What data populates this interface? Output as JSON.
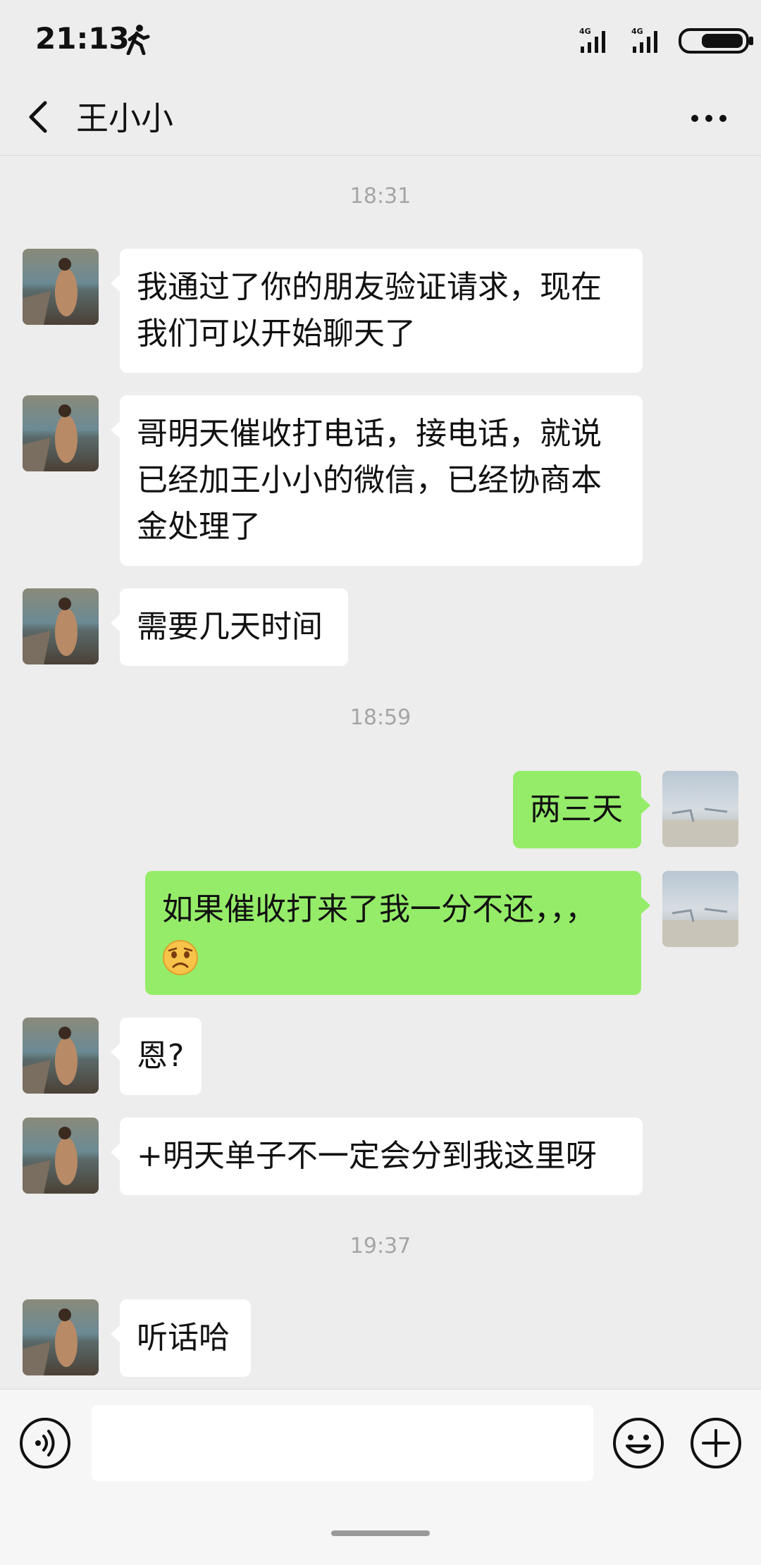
{
  "status_bar": {
    "time": "21:13",
    "network_1": "4G",
    "network_2": "4G",
    "icons": [
      "walk-icon",
      "signal-icon",
      "signal-icon",
      "battery-icon"
    ]
  },
  "header": {
    "title": "王小小",
    "icons": [
      "back-icon",
      "more-icon"
    ]
  },
  "chat": {
    "timestamps": [
      "18:31",
      "18:59",
      "19:37"
    ],
    "messages": [
      {
        "sender": "other",
        "text_lines": [
          "我通过了你的朋友验证请求，现在",
          "我们可以开始聊天了"
        ]
      },
      {
        "sender": "other",
        "text_lines": [
          "哥明天催收打电话，接电话，就说",
          "已经加王小小的微信，已经协商本",
          "金处理了"
        ]
      },
      {
        "sender": "other",
        "text": "需要几天时间"
      },
      {
        "sender": "self",
        "text": "两三天"
      },
      {
        "sender": "self",
        "text": "如果催收打来了我一分不还，，，",
        "emoji": "sad-face-icon"
      },
      {
        "sender": "other",
        "text": "恩?"
      },
      {
        "sender": "other",
        "text": "+明天单子不一定会分到我这里呀"
      },
      {
        "sender": "other",
        "text": "听话哈"
      }
    ]
  },
  "input_bar": {
    "placeholder": "",
    "icons": [
      "voice-icon",
      "emoji-icon",
      "plus-icon"
    ]
  },
  "colors": {
    "background": "#ededed",
    "self_bubble": "#95ec69",
    "other_bubble": "#ffffff",
    "timestamp": "#a5a5a5"
  }
}
